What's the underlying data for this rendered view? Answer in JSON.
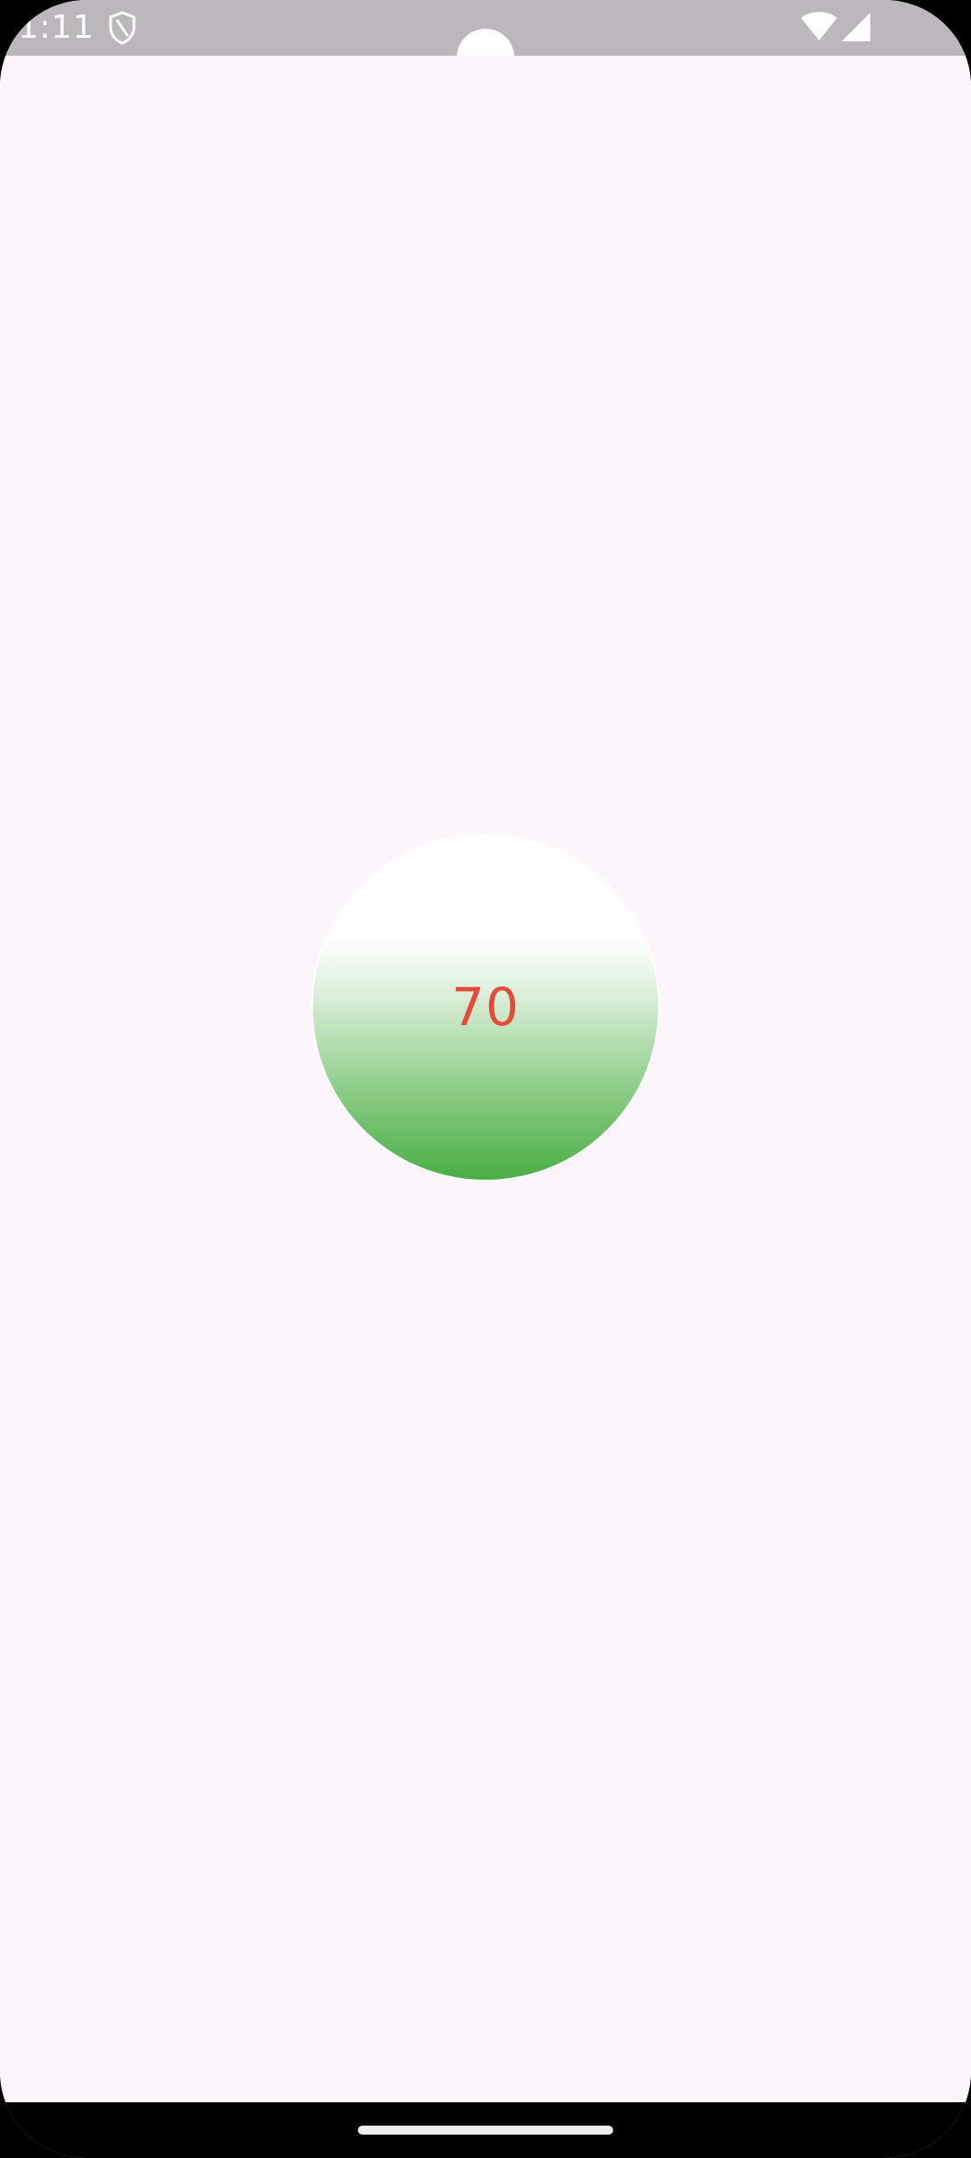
{
  "status_bar": {
    "time": "1:11",
    "icons": [
      "shield-icon",
      "wifi-icon",
      "signal-icon"
    ]
  },
  "gauge": {
    "value": "70",
    "value_color": "#e54b3b",
    "fill_color": "#4aae45"
  }
}
